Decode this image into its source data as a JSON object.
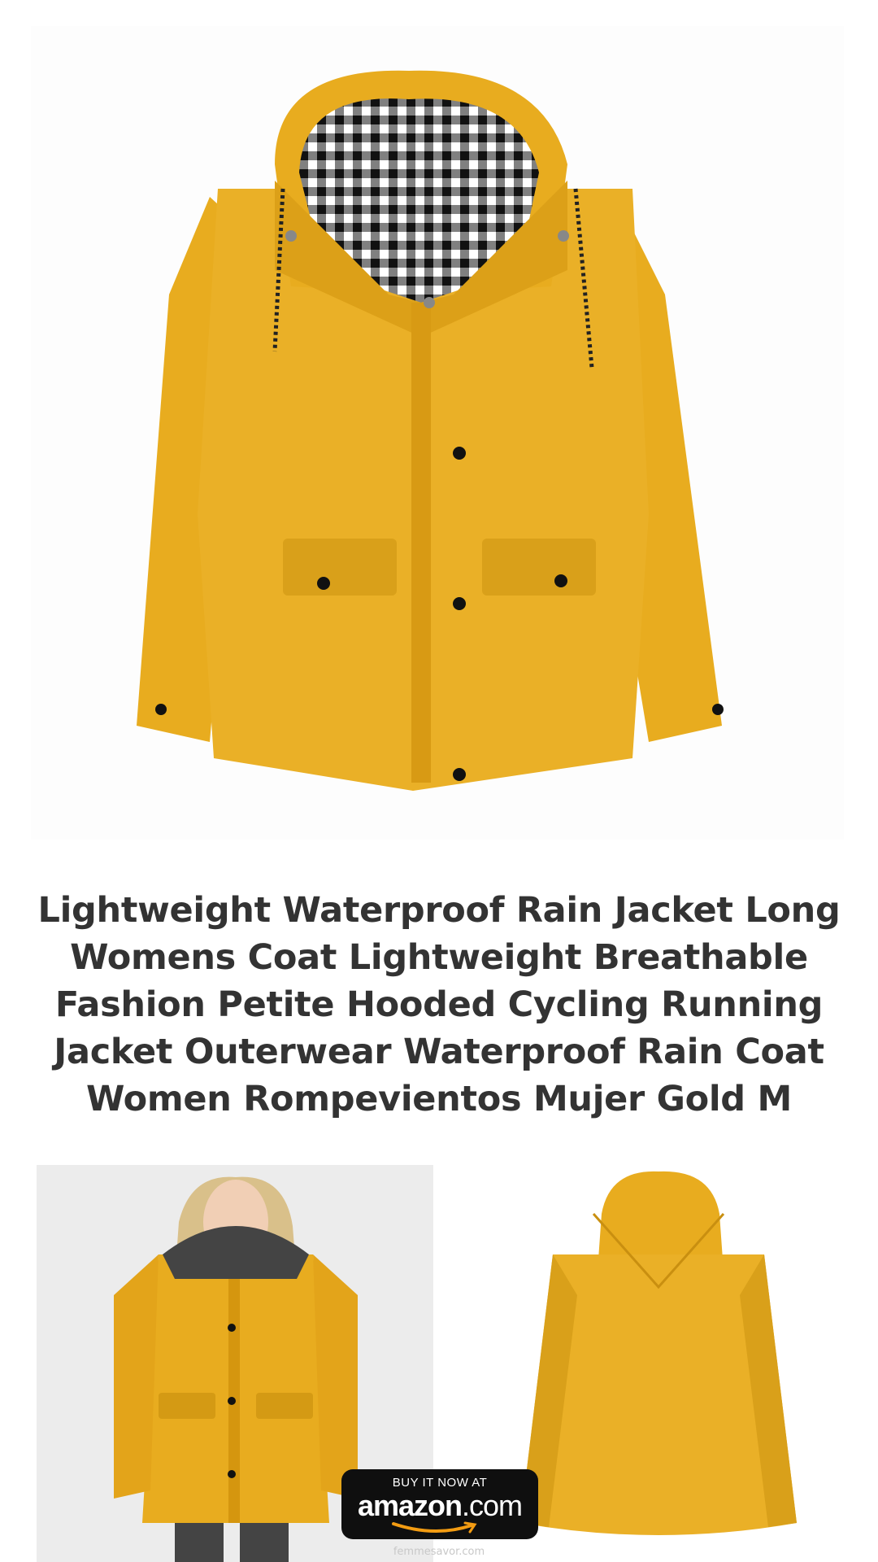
{
  "product": {
    "title": "Lightweight Waterproof Rain Jacket Long Womens Coat Lightweight Breathable Fashion Petite Hooded Cycling Running Jacket Outerwear Waterproof Rain Coat Women Rompevientos Mujer Gold M"
  },
  "images": {
    "main_icon": "yellow-rain-jacket-front",
    "model_icon": "model-wearing-jacket",
    "back_icon": "yellow-rain-jacket-back"
  },
  "cta": {
    "top_text": "BUY IT NOW AT",
    "logo_main": "amazon",
    "logo_suffix": ".com"
  },
  "footer": {
    "site": "femmesavor.com"
  },
  "colors": {
    "jacket": "#e8ac1f",
    "jacket_shadow": "#c98f10",
    "button_bg": "#0f0f0f",
    "smile": "#f39c12",
    "title_text": "#333333"
  }
}
